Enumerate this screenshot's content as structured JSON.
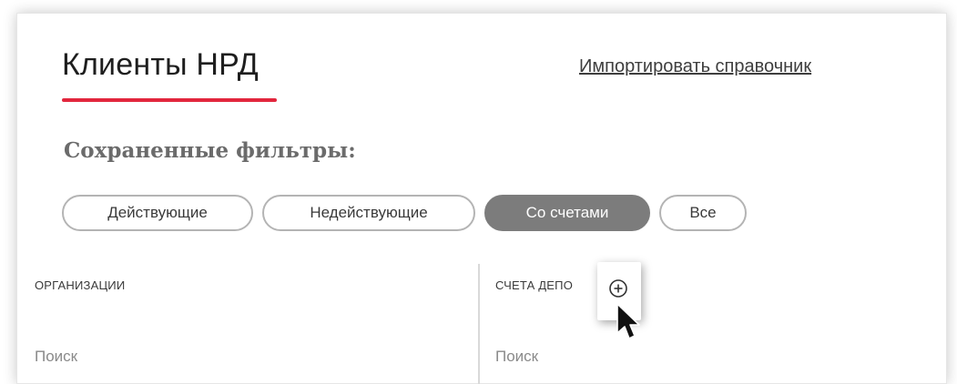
{
  "header": {
    "title": "Клиенты НРД",
    "import_link": "Импортировать справочник"
  },
  "filters": {
    "label": "Сохраненные фильтры:",
    "chips": [
      {
        "label": "Действующие",
        "active": false
      },
      {
        "label": "Недействующие",
        "active": false
      },
      {
        "label": "Со счетами",
        "active": true
      },
      {
        "label": "Все",
        "active": false
      }
    ]
  },
  "columns": [
    {
      "header": "ОРГАНИЗАЦИИ",
      "search_placeholder": "Поиск"
    },
    {
      "header": "СЧЕТА ДЕПО",
      "search_placeholder": "Поиск"
    }
  ],
  "colors": {
    "accent": "#e2263d",
    "chip_active_bg": "#7c7c7c",
    "chip_border": "#b4b4b4"
  },
  "icons": {
    "zoom": "zoom-in-icon",
    "cursor": "mouse-pointer-icon"
  }
}
